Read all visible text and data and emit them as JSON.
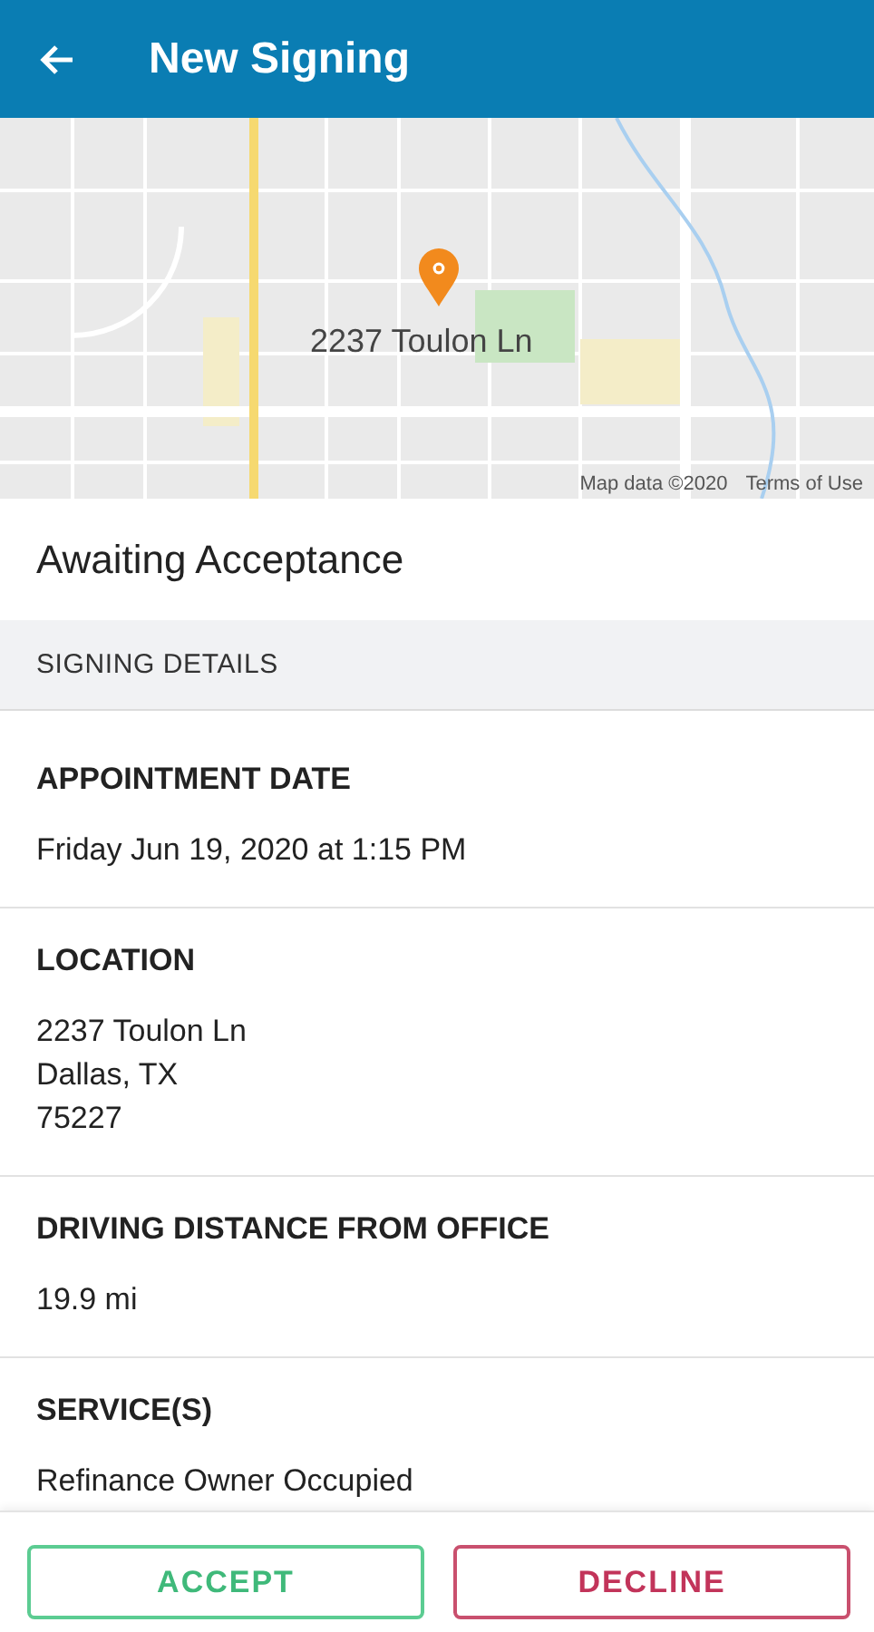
{
  "app_bar": {
    "title": "New Signing"
  },
  "map": {
    "kind": "picture",
    "marker_label": "2237 Toulon Ln",
    "attribution": "Map data ©2020",
    "terms_link": "Terms of Use"
  },
  "status": "Awaiting Acceptance",
  "section_header": "SIGNING DETAILS",
  "fields": [
    {
      "label": "APPOINTMENT DATE",
      "lines": [
        "Friday Jun 19, 2020 at 1:15 PM"
      ]
    },
    {
      "label": "LOCATION",
      "lines": [
        "2237 Toulon Ln",
        "Dallas, TX",
        "75227"
      ]
    },
    {
      "label": "DRIVING DISTANCE FROM OFFICE",
      "lines": [
        "19.9 mi"
      ]
    },
    {
      "label": "SERVICE(S)",
      "lines": [
        "Refinance Owner Occupied"
      ]
    }
  ],
  "buttons": [
    {
      "label": "ACCEPT",
      "kind": "accept"
    },
    {
      "label": "DECLINE",
      "kind": "decline"
    }
  ]
}
